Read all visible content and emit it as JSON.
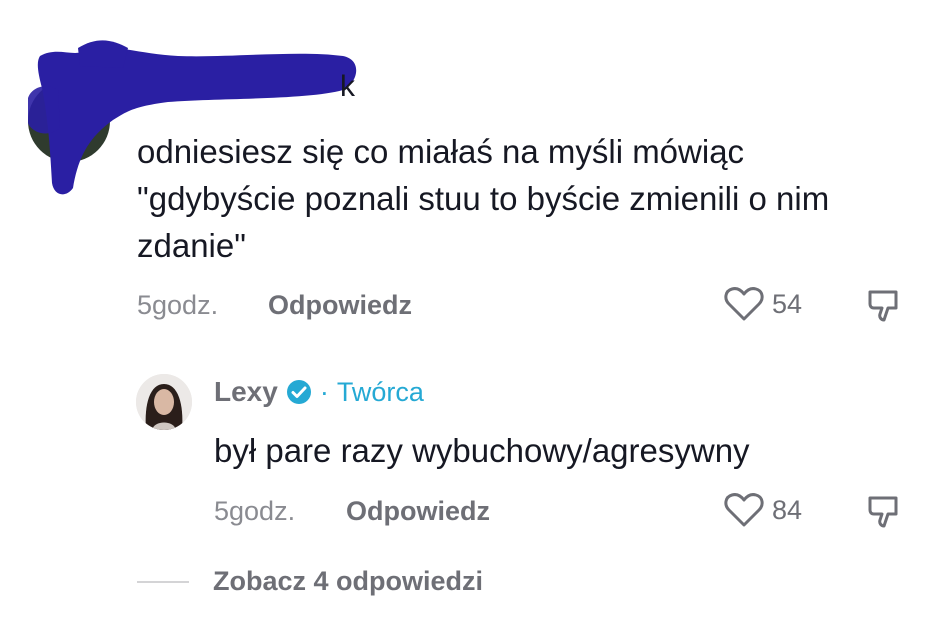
{
  "top_comment": {
    "text": "odniesiesz się co miałaś na myśli mówiąc \"gdybyście poznali stuu to byście zmienili o nim zdanie\"",
    "time": "5godz.",
    "reply_label": "Odpowiedz",
    "likes": "54",
    "redaction_color": "#2a1fa3"
  },
  "reply_comment": {
    "author": "Lexy",
    "role_label": "Twórca",
    "text": "był pare razy wybuchowy/agresywny",
    "time": "5godz.",
    "reply_label": "Odpowiedz",
    "likes": "84",
    "verified_color": "#25a9d4"
  },
  "view_replies": {
    "label": "Zobacz 4 odpowiedzi"
  }
}
